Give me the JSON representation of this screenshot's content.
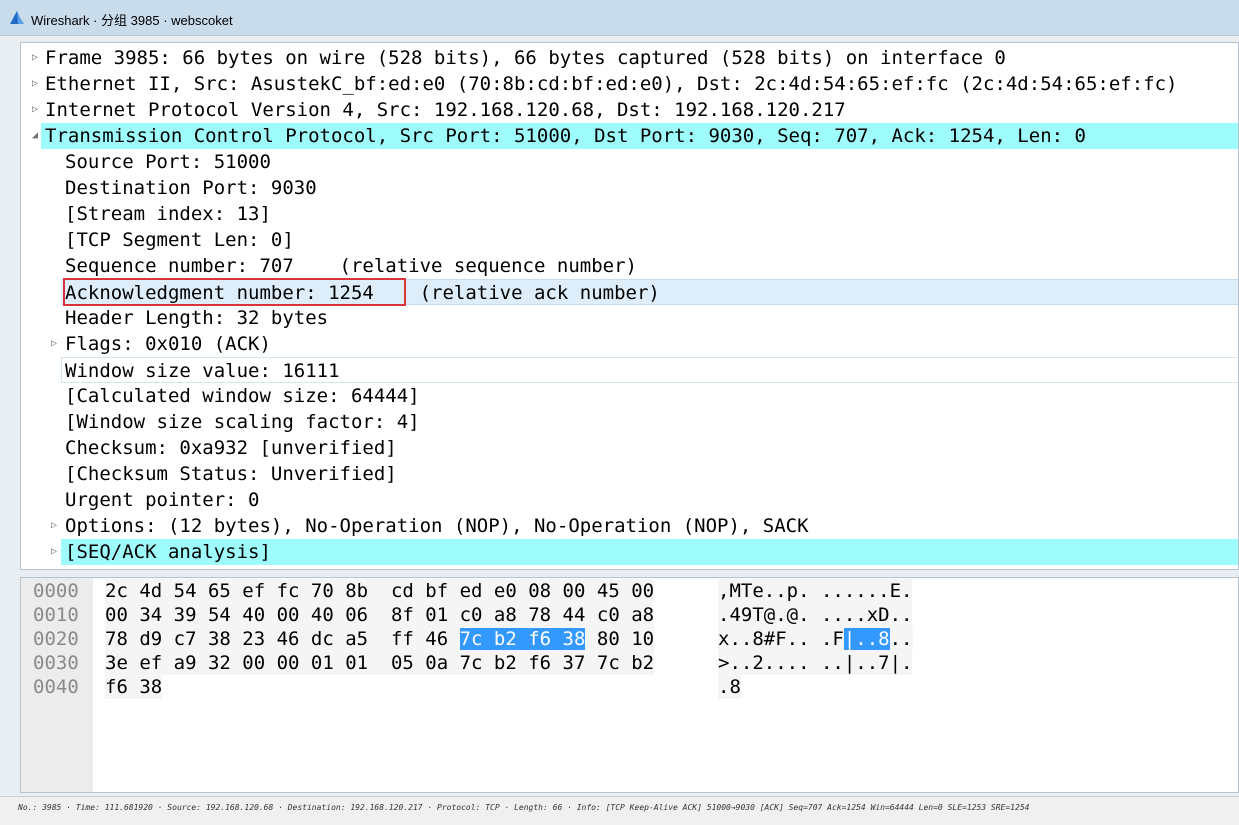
{
  "window": {
    "title": "Wireshark · 分组 3985 · webscoket"
  },
  "tree": {
    "rows": [
      {
        "arrow": "▷",
        "text": "Frame 3985: 66 bytes on wire (528 bits), 66 bytes captured (528 bits) on interface 0"
      },
      {
        "arrow": "▷",
        "text": "Ethernet II, Src: AsustekC_bf:ed:e0 (70:8b:cd:bf:ed:e0), Dst: 2c:4d:54:65:ef:fc (2c:4d:54:65:ef:fc)"
      },
      {
        "arrow": "▷",
        "text": "Internet Protocol Version 4, Src: 192.168.120.68, Dst: 192.168.120.217"
      },
      {
        "arrow": "◢",
        "text": "Transmission Control Protocol, Src Port: 51000, Dst Port: 9030, Seq: 707, Ack: 1254, Len: 0"
      },
      {
        "arrow": "",
        "text": "Source Port: 51000"
      },
      {
        "arrow": "",
        "text": "Destination Port: 9030"
      },
      {
        "arrow": "",
        "text": "[Stream index: 13]"
      },
      {
        "arrow": "",
        "text": "[TCP Segment Len: 0]"
      },
      {
        "arrow": "",
        "text": "Sequence number: 707    (relative sequence number)"
      },
      {
        "arrow": "",
        "text": "Acknowledgment number: 1254    (relative ack number)"
      },
      {
        "arrow": "",
        "text": "Header Length: 32 bytes"
      },
      {
        "arrow": "▷",
        "text": "Flags: 0x010 (ACK)"
      },
      {
        "arrow": "",
        "text": "Window size value: 16111"
      },
      {
        "arrow": "",
        "text": "[Calculated window size: 64444]"
      },
      {
        "arrow": "",
        "text": "[Window size scaling factor: 4]"
      },
      {
        "arrow": "",
        "text": "Checksum: 0xa932 [unverified]"
      },
      {
        "arrow": "",
        "text": "[Checksum Status: Unverified]"
      },
      {
        "arrow": "",
        "text": "Urgent pointer: 0"
      },
      {
        "arrow": "▷",
        "text": "Options: (12 bytes), No-Operation (NOP), No-Operation (NOP), SACK"
      },
      {
        "arrow": "▷",
        "text": "[SEQ/ACK analysis]"
      }
    ]
  },
  "bytes": {
    "rows": [
      {
        "offset": "0000",
        "hex_pre": "2c 4d 54 65 ef fc 70 8b  cd bf ed e0 08 00 45 00",
        "hex_sel": "",
        "hex_post": "",
        "ascii_pre": ",MTe..p. ......E.",
        "ascii_sel": "",
        "ascii_post": ""
      },
      {
        "offset": "0010",
        "hex_pre": "00 34 39 54 40 00 40 06  8f 01 c0 a8 78 44 c0 a8",
        "hex_sel": "",
        "hex_post": "",
        "ascii_pre": ".49T@.@. ....xD..",
        "ascii_sel": "",
        "ascii_post": ""
      },
      {
        "offset": "0020",
        "hex_pre": "78 d9 c7 38 23 46 dc a5  ff 46 ",
        "hex_sel": "7c b2 f6 38",
        "hex_post": " 80 10",
        "ascii_pre": "x..8#F.. .F",
        "ascii_sel": "|..8",
        "ascii_post": ".."
      },
      {
        "offset": "0030",
        "hex_pre": "3e ef a9 32 00 00 01 01  05 0a 7c b2 f6 37 7c b2",
        "hex_sel": "",
        "hex_post": "",
        "ascii_pre": ">..2.... ..|..7|.",
        "ascii_sel": "",
        "ascii_post": ""
      },
      {
        "offset": "0040",
        "hex_pre": "f6 38",
        "hex_sel": "",
        "hex_post": "",
        "ascii_pre": ".8",
        "ascii_sel": "",
        "ascii_post": ""
      }
    ]
  },
  "status": {
    "text": "No.: 3985 · Time: 111.681920 · Source: 192.168.120.68 · Destination: 192.168.120.217 · Protocol: TCP · Length: 66 · Info: [TCP Keep-Alive ACK] 51000→9030 [ACK] Seq=707 Ack=1254 Win=64444 Len=0 SLE=1253 SRE=1254"
  },
  "colors": {
    "cyan_highlight": "#9ffcfc",
    "selected_row": "#ddeefa",
    "byte_selection": "#3399ff",
    "annotation_box": "#d9343b"
  }
}
